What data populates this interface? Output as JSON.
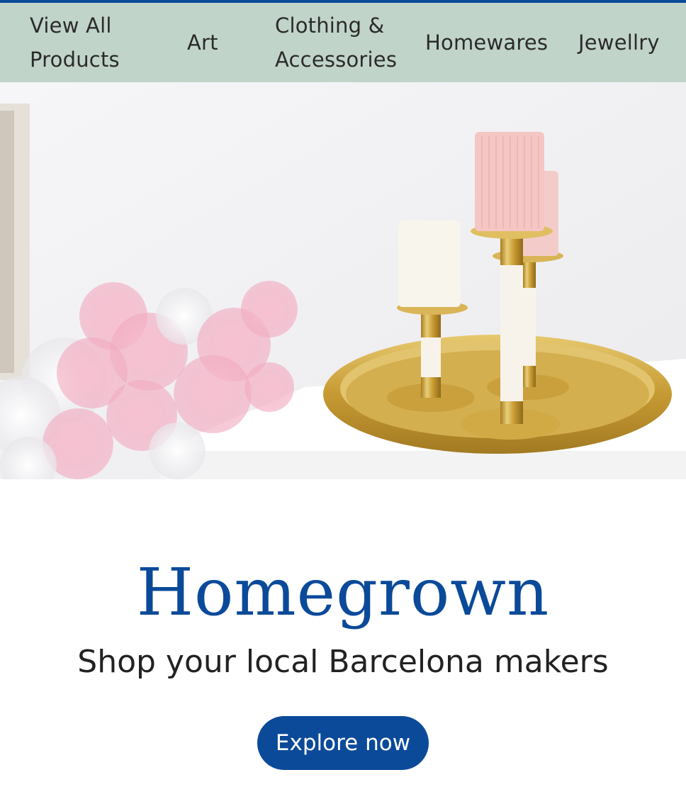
{
  "nav": {
    "items": [
      {
        "line1": "View All",
        "line2": "Products"
      },
      {
        "line1": "Art",
        "line2": ""
      },
      {
        "line1": "Clothing &",
        "line2": "Accessories"
      },
      {
        "line1": "Homewares",
        "line2": ""
      },
      {
        "line1": "Jewellry",
        "line2": ""
      }
    ]
  },
  "hero": {
    "image": "candle-holders-with-pink-blossoms"
  },
  "brand": {
    "title": "Homegrown",
    "tagline": "Shop your local Barcelona makers",
    "cta_label": "Explore now"
  },
  "colors": {
    "accent": "#0b4a99",
    "nav_bg": "#c1d4ca",
    "top_bar": "#0a4a9a"
  }
}
